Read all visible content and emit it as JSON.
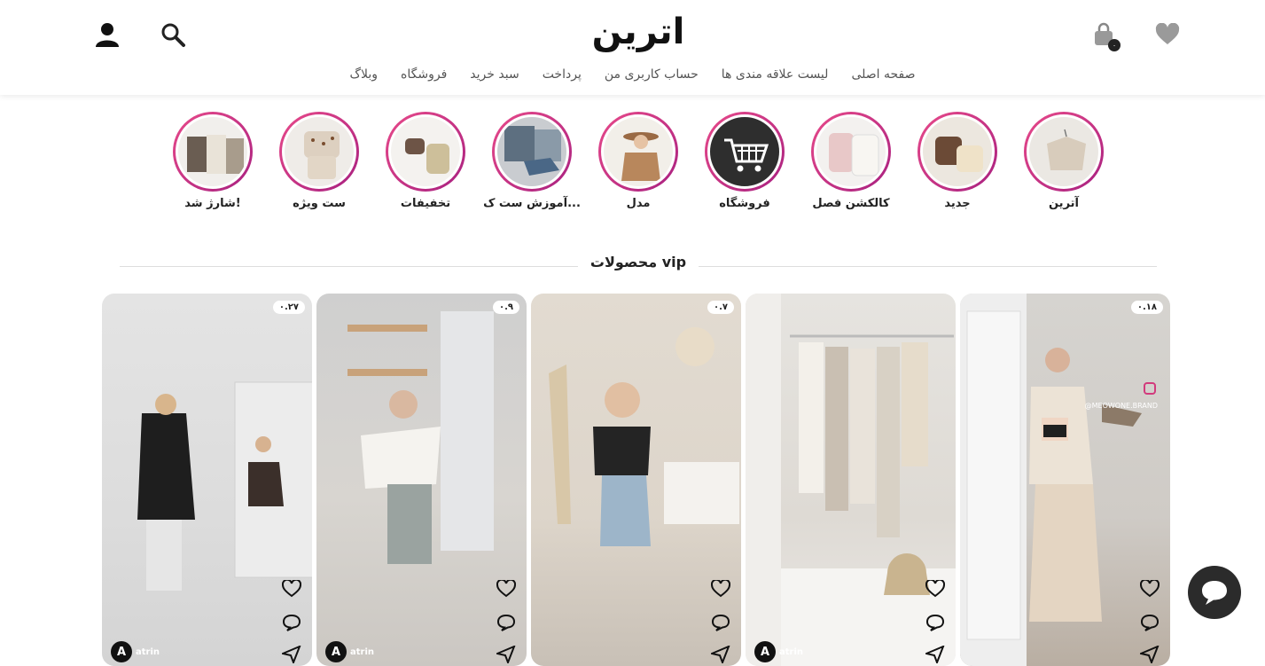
{
  "header": {
    "logo": "اترین",
    "cart_count": "۰",
    "icons": [
      "heart-icon",
      "bag-icon",
      "search-icon",
      "user-icon"
    ]
  },
  "nav": {
    "items": [
      {
        "label": "صفحه اصلی"
      },
      {
        "label": "لیست علاقه مندی ها"
      },
      {
        "label": "حساب کاربری من"
      },
      {
        "label": "پرداخت"
      },
      {
        "label": "سبد خرید"
      },
      {
        "label": "فروشگاه"
      },
      {
        "label": "وبلاگ"
      }
    ]
  },
  "stories": [
    {
      "label": "آترین"
    },
    {
      "label": "جدید"
    },
    {
      "label": "کالکشن فصل"
    },
    {
      "label": "فروشگاه"
    },
    {
      "label": "مدل"
    },
    {
      "label": "آموزش ست ک..."
    },
    {
      "label": "تخفیفات"
    },
    {
      "label": "ست ویژه"
    },
    {
      "label": "شارژ شد!"
    }
  ],
  "section": {
    "title": "محصولات vip"
  },
  "cards": [
    {
      "count": "۰.۱۸",
      "brand": "",
      "tag": "@MEOWONE.BRAND"
    },
    {
      "count": "",
      "brand": "atrin",
      "tag": ""
    },
    {
      "count": "۰.۷",
      "brand": "",
      "tag": ""
    },
    {
      "count": "۰.۹",
      "brand": "atrin",
      "tag": ""
    },
    {
      "count": "۰.۲۷",
      "brand": "atrin",
      "tag": ""
    }
  ],
  "colors": {
    "ring_start": "#e84a8a",
    "ring_end": "#a82080",
    "chat_bg": "#2b2b2b",
    "heart": "#9a9a9a"
  }
}
